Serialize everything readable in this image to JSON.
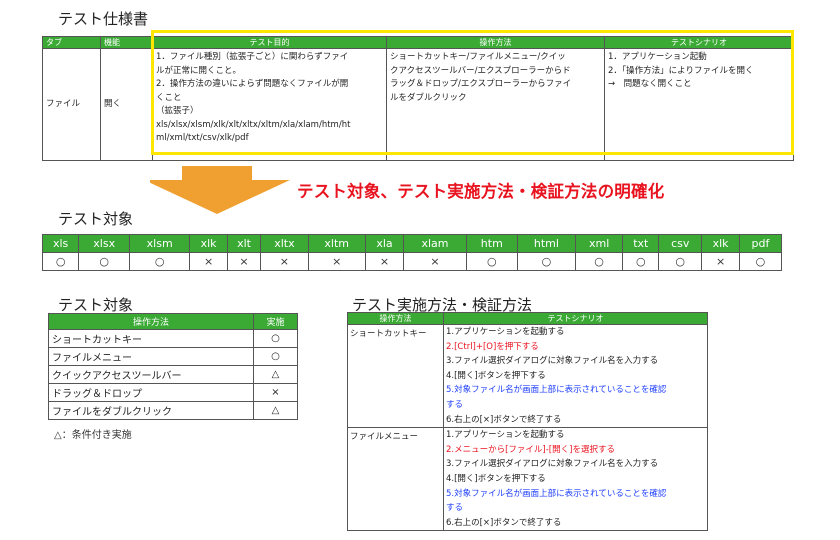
{
  "spec": {
    "title": "テスト仕様書",
    "headers": {
      "type": "タブ",
      "func": "機能",
      "purpose": "テスト目的",
      "op": "操作方法",
      "scenario": "テストシナリオ"
    },
    "row": {
      "type": "ファイル",
      "func": "開く",
      "purpose_lines": [
        "1．ファイル種別（拡張子ごと）に関わらずファイ",
        "ルが正常に開くこと。",
        "2．操作方法の違いによらず問題なくファイルが開",
        "くこと",
        "（拡張子）",
        "xls/xlsx/xlsm/xlk/xlt/xltx/xltm/xla/xlam/htm/ht",
        "ml/xml/txt/csv/xlk/pdf"
      ],
      "op_lines": [
        "ショートカットキー/ファイルメニュー/クイッ",
        "クアクセスツールバー/エクスプローラーからド",
        "ラッグ＆ドロップ/エクスプローラーからファイ",
        "ルをダブルクリック"
      ],
      "scenario_lines": [
        "1．アプリケーション起動",
        "2．「操作方法」によりファイルを開く",
        "→　問題なく開くこと"
      ]
    }
  },
  "banner": "テスト対象、テスト実施方法・検証方法の明確化",
  "colors": {
    "header_green": "#3aaa35",
    "banner_red": "#e8131f",
    "arrow_orange": "#f0a030",
    "highlight_yellow": "#ffe600",
    "step_blue": "#1f3fff"
  },
  "target": {
    "title": "テスト対象",
    "extensions": [
      "xls",
      "xlsx",
      "xlsm",
      "xlk",
      "xlt",
      "xltx",
      "xltm",
      "xla",
      "xlam",
      "htm",
      "html",
      "xml",
      "txt",
      "csv",
      "xlk",
      "pdf"
    ],
    "marks": [
      "○",
      "○",
      "○",
      "×",
      "×",
      "×",
      "×",
      "×",
      "×",
      "○",
      "○",
      "○",
      "○",
      "○",
      "×",
      "○"
    ]
  },
  "ops": {
    "title": "テスト対象",
    "header_method": "操作方法",
    "header_done": "実施",
    "rows": [
      {
        "label": "ショートカットキー",
        "mark": "○"
      },
      {
        "label": "ファイルメニュー",
        "mark": "○"
      },
      {
        "label": "クイックアクセスツールバー",
        "mark": "△"
      },
      {
        "label": "ドラッグ＆ドロップ",
        "mark": "×"
      },
      {
        "label": "ファイルをダブルクリック",
        "mark": "△"
      }
    ],
    "note": "△：条件付き実施"
  },
  "method": {
    "title": "テスト実施方法・検証方法",
    "header_method": "操作方法",
    "header_scenario": "テストシナリオ",
    "rows": [
      {
        "label": "ショートカットキー",
        "steps": [
          {
            "text": "1.アプリケーションを起動する",
            "color": "black"
          },
          {
            "text": "2.[Ctrl]+[O]を押下する",
            "color": "red"
          },
          {
            "text": "3.ファイル選択ダイアログに対象ファイル名を入力する",
            "color": "black"
          },
          {
            "text": "4.[開く]ボタンを押下する",
            "color": "black"
          },
          {
            "text": "5.対象ファイル名が画面上部に表示されていることを確認",
            "color": "blue"
          },
          {
            "text": "する",
            "color": "blue"
          },
          {
            "text": "6.右上の[×]ボタンで終了する",
            "color": "black"
          }
        ]
      },
      {
        "label": "ファイルメニュー",
        "steps": [
          {
            "text": "1.アプリケーションを起動する",
            "color": "black"
          },
          {
            "text": "2.メニューから[ファイル]-[開く]を選択する",
            "color": "red"
          },
          {
            "text": "3.ファイル選択ダイアログに対象ファイル名を入力する",
            "color": "black"
          },
          {
            "text": "4.[開く]ボタンを押下する",
            "color": "black"
          },
          {
            "text": "5.対象ファイル名が画面上部に表示されていることを確認",
            "color": "blue"
          },
          {
            "text": "する",
            "color": "blue"
          },
          {
            "text": "6.右上の[×]ボタンで終了する",
            "color": "black"
          }
        ]
      }
    ]
  }
}
